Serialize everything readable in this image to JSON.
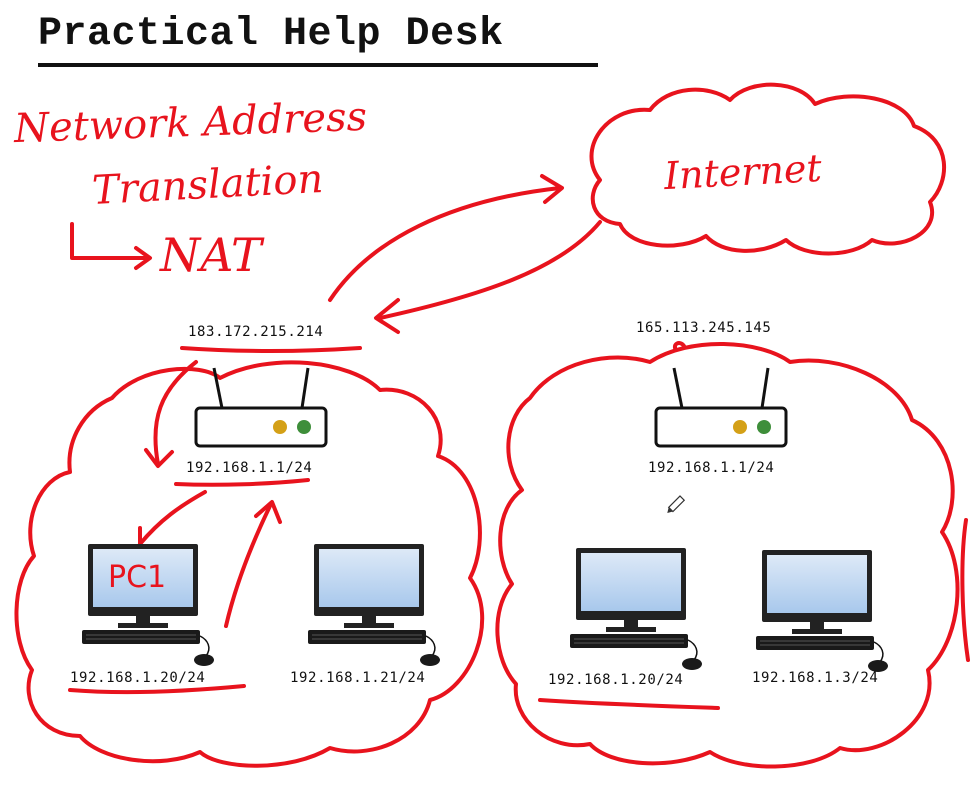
{
  "title": "Practical Help Desk",
  "annotations": {
    "line1": "Network Address",
    "line2": "Translation",
    "acronym": "NAT",
    "internet": "Internet",
    "pc_label": "PC1"
  },
  "network_left": {
    "public_ip": "183.172.215.214",
    "router_ip": "192.168.1.1/24",
    "hosts": [
      "192.168.1.20/24",
      "192.168.1.21/24"
    ]
  },
  "network_right": {
    "public_ip": "165.113.245.145",
    "router_ip": "192.168.1.1/24",
    "hosts": [
      "192.168.1.20/24",
      "192.168.1.3/24"
    ]
  },
  "colors": {
    "ink": "#e8131d",
    "router_led_amber": "#d4a017",
    "router_led_green": "#3e8e3a",
    "screen_blue": "#a8c8ec"
  },
  "icons": [
    "router-icon",
    "computer-icon",
    "pencil-cursor-icon"
  ]
}
